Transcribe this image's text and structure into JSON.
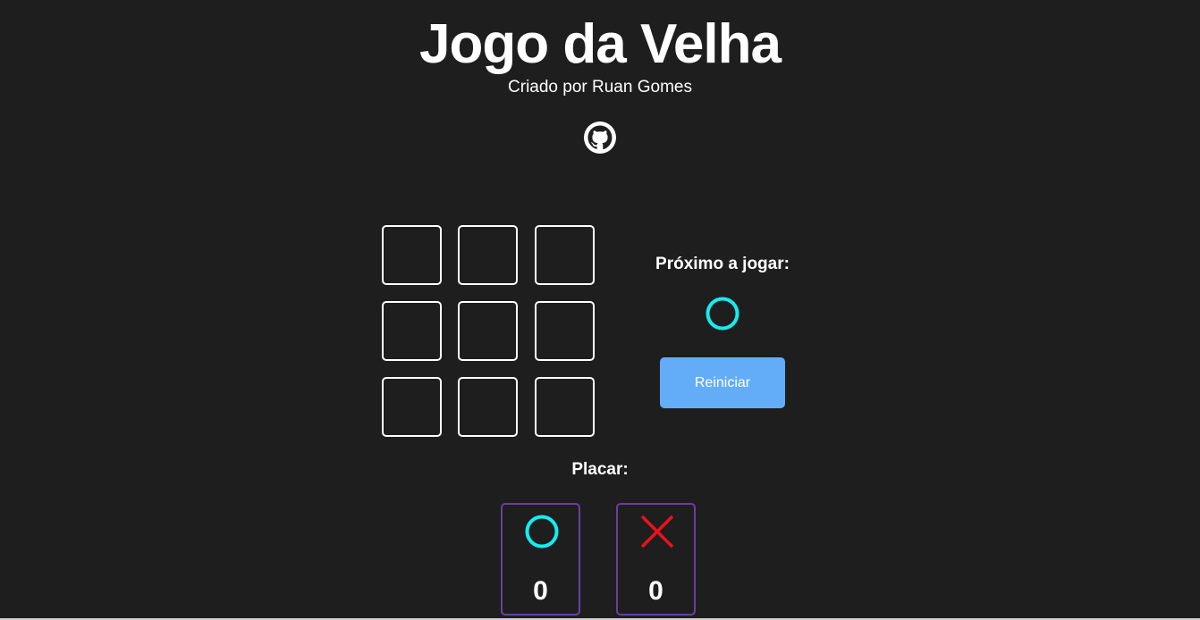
{
  "header": {
    "title": "Jogo da Velha",
    "subtitle": "Criado por Ruan Gomes",
    "github_icon": "github-icon"
  },
  "board": {
    "cells": [
      "",
      "",
      "",
      "",
      "",
      "",
      "",
      "",
      ""
    ]
  },
  "turn": {
    "label": "Próximo a jogar:",
    "next_player": "O",
    "next_player_icon": "circle-icon"
  },
  "controls": {
    "reset_label": "Reiniciar"
  },
  "score": {
    "label": "Placar:",
    "players": [
      {
        "symbol": "O",
        "icon": "circle-icon",
        "value": "0"
      },
      {
        "symbol": "X",
        "icon": "cross-icon",
        "value": "0"
      }
    ]
  },
  "colors": {
    "background": "#1e1e1e",
    "circle": "#15ecf0",
    "cross": "#e8131a",
    "button": "#63adf8",
    "card_border": "#6b3fa0"
  }
}
